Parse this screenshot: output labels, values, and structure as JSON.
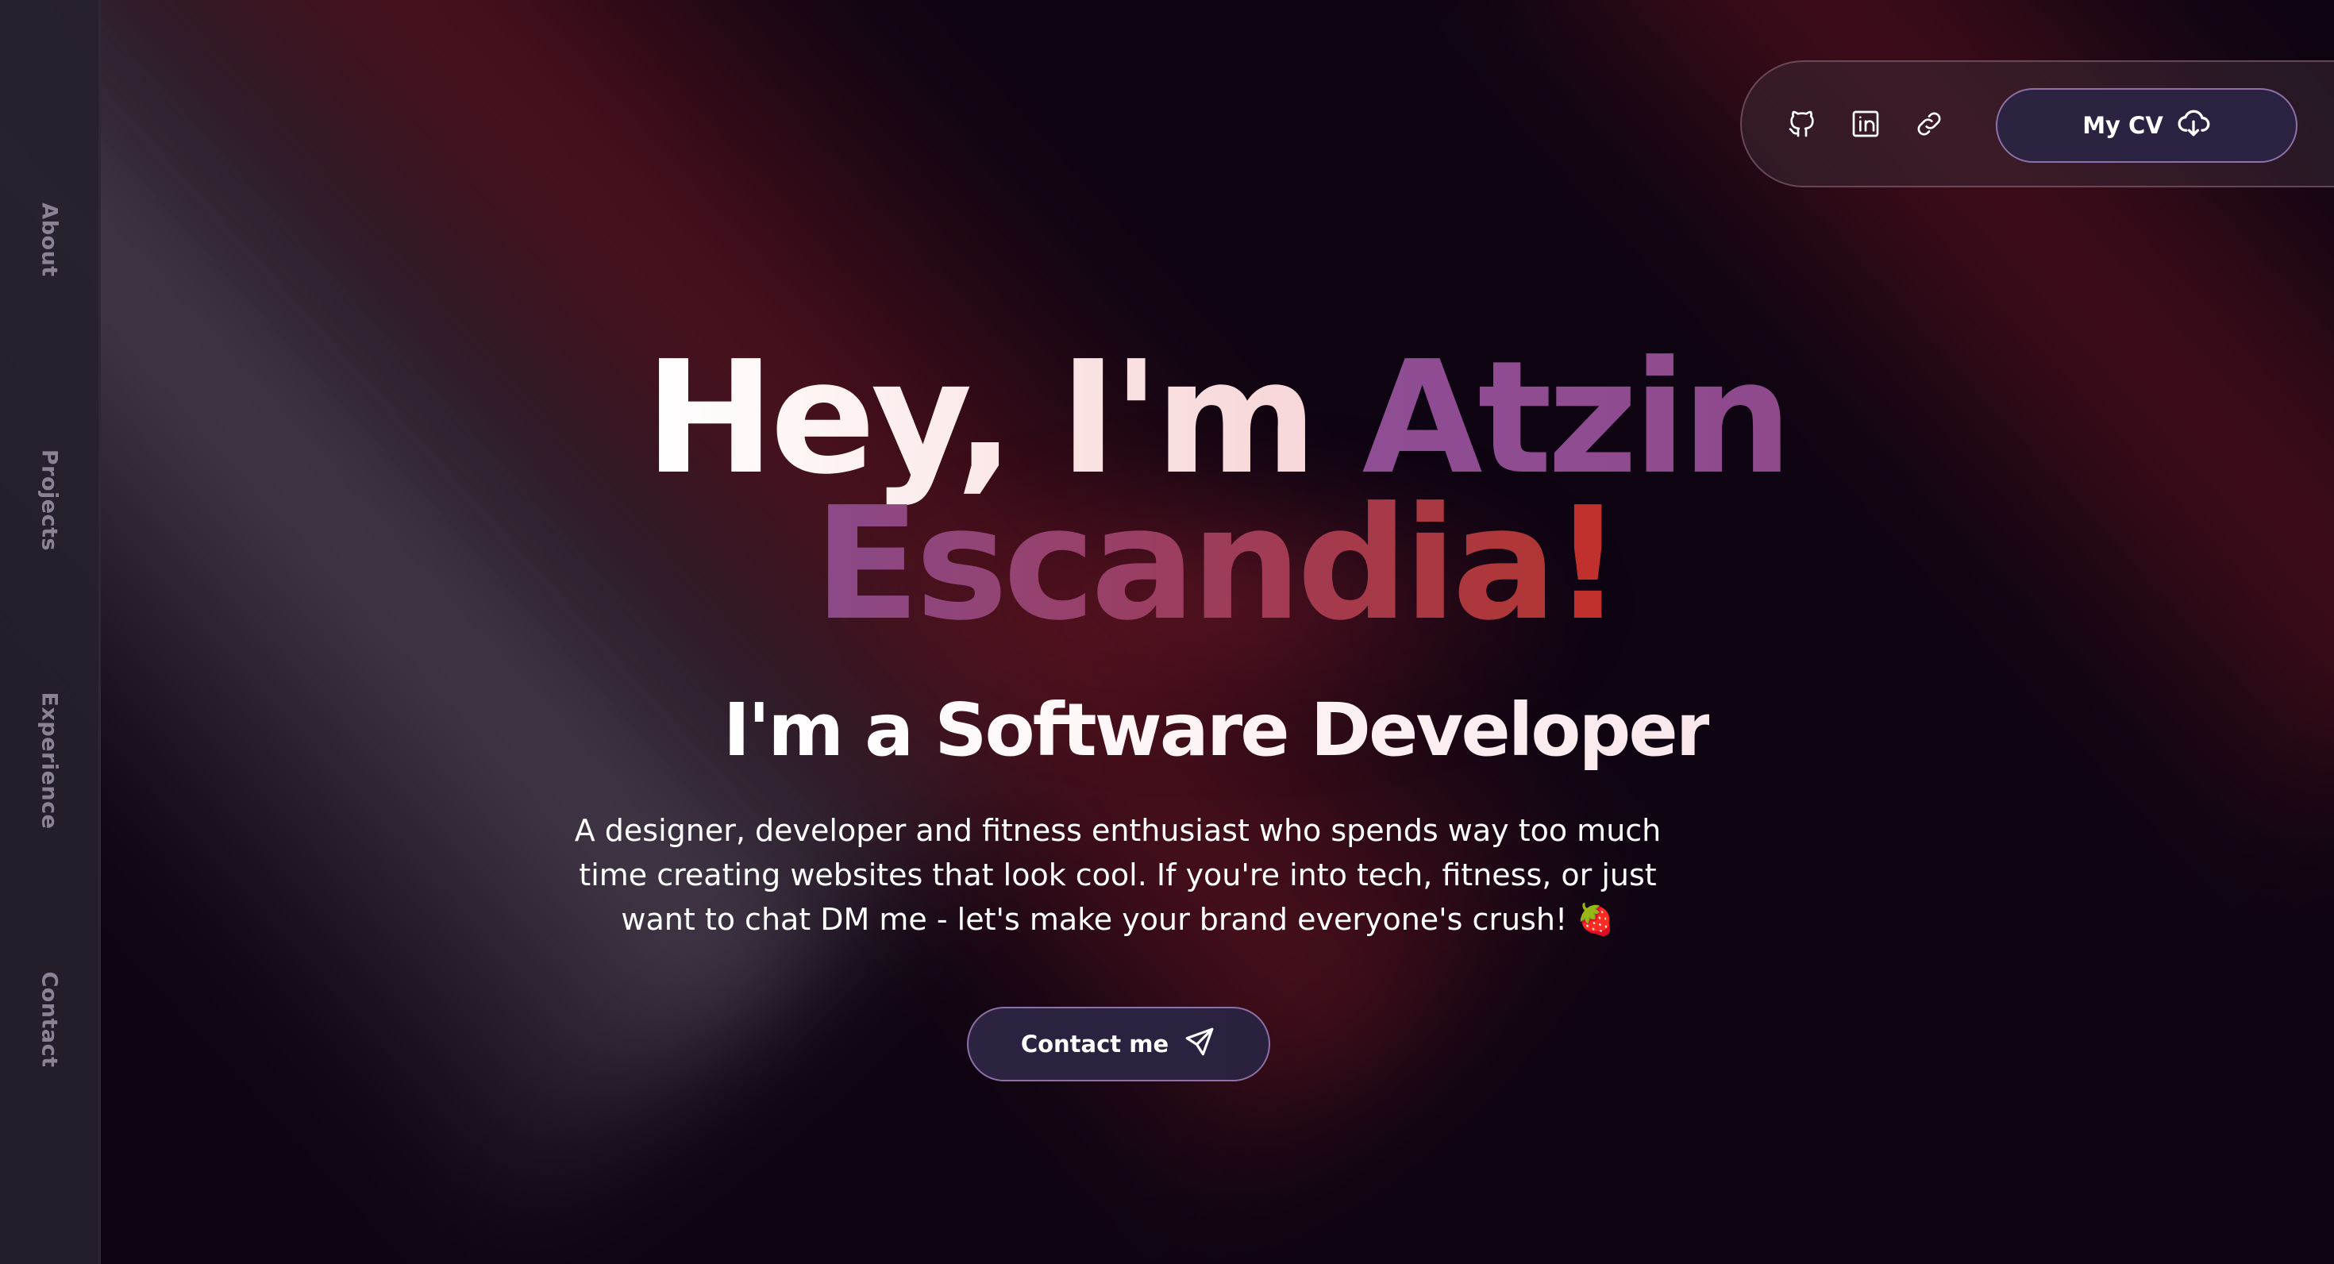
{
  "sidebar": {
    "items": [
      {
        "label": "About"
      },
      {
        "label": "Projects"
      },
      {
        "label": "Experience"
      },
      {
        "label": "Contact"
      }
    ]
  },
  "social": {
    "icons": [
      "github-icon",
      "linkedin-icon",
      "link-icon"
    ],
    "cv_label": "My CV",
    "cv_icon": "cloud-download-icon"
  },
  "hero": {
    "greeting": "Hey, I'm ",
    "first_name": "Atzin",
    "last_name": "Escandia",
    "exclamation": "!",
    "subtitle": "I'm a Software Developer",
    "bio": "A designer, developer and fitness enthusiast who spends way too much time creating websites that look cool. If you're into tech, fitness, or just want to chat DM me - let's make your brand everyone's crush! 🍓",
    "contact_label": "Contact me",
    "contact_icon": "send-icon"
  },
  "colors": {
    "background": "#0e0412",
    "sidebar": "#261f2c",
    "accent_purple": "#8f4d94",
    "accent_red": "#c0302c",
    "button_bg": "#2b2340",
    "button_border": "#8f6fa8"
  }
}
